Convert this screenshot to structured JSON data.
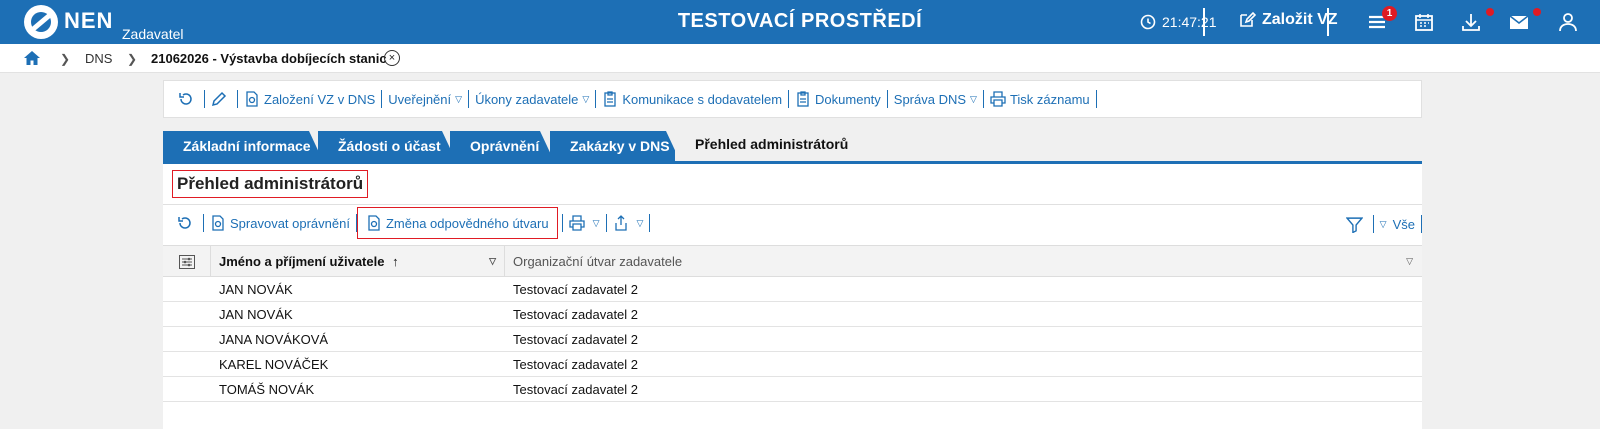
{
  "header": {
    "logo_text": "NEN",
    "logo_sub": "Zadavatel",
    "env_title": "TESTOVACÍ PROSTŘEDÍ",
    "time": "21:47:21",
    "create_label": "Založit VZ",
    "menu_badge": "1"
  },
  "breadcrumb": {
    "items": [
      "DNS"
    ],
    "current": "21062026 - Výstavba dobíjecích stanic",
    "close_symbol": "×"
  },
  "main_toolbar": {
    "items": [
      {
        "label": "Založení VZ v DNS"
      },
      {
        "label": "Uveřejnění"
      },
      {
        "label": "Úkony zadavatele"
      },
      {
        "label": "Komunikace s dodavatelem"
      },
      {
        "label": "Dokumenty"
      },
      {
        "label": "Správa DNS"
      },
      {
        "label": "Tisk záznamu"
      }
    ]
  },
  "tabs": [
    {
      "label": "Základní informace"
    },
    {
      "label": "Žádosti o účast"
    },
    {
      "label": "Oprávnění"
    },
    {
      "label": "Zakázky v DNS"
    },
    {
      "label": "Přehled administrátorů",
      "active": true
    }
  ],
  "section": {
    "title": "Přehled administrátorů"
  },
  "grid_toolbar": {
    "manage_label": "Spravovat oprávnění",
    "change_label": "Změna odpovědného útvaru",
    "all_label": "Vše"
  },
  "table": {
    "columns": [
      "Jméno a příjmení uživatele",
      "Organizační útvar zadavatele"
    ],
    "sort_arrow": "↑",
    "rows": [
      {
        "name": "JAN NOVÁK",
        "unit": "Testovací zadavatel 2"
      },
      {
        "name": "JAN NOVÁK",
        "unit": "Testovací zadavatel 2"
      },
      {
        "name": "JANA NOVÁKOVÁ",
        "unit": "Testovací zadavatel 2"
      },
      {
        "name": "KAREL NOVÁČEK",
        "unit": "Testovací zadavatel 2"
      },
      {
        "name": "TOMÁŠ NOVÁK",
        "unit": "Testovací zadavatel 2"
      }
    ]
  },
  "colors": {
    "brand_blue": "#1d6fb5",
    "alert_red": "#e01b24"
  },
  "icons": [
    "clock-icon",
    "edit-icon",
    "menu-icon",
    "calendar-icon",
    "download-icon",
    "mail-icon",
    "user-icon",
    "home-icon",
    "refresh-icon",
    "pencil-icon",
    "document-gear-icon",
    "clipboard-icon",
    "print-icon",
    "export-icon",
    "filter-icon",
    "column-settings-icon"
  ]
}
